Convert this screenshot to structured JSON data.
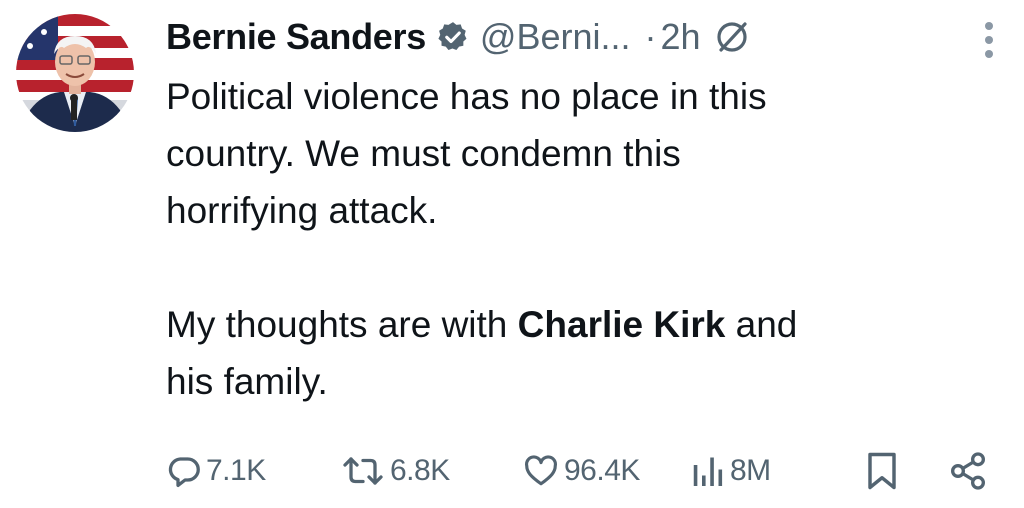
{
  "author": {
    "name": "Bernie Sanders",
    "handle": "@Berni...",
    "separator": "·",
    "time": "2h",
    "avatar_icon": "profile-photo",
    "verified_icon": "verified-badge-icon",
    "verified_color": "#536471"
  },
  "tweet": {
    "line1": "Political violence has no place in this",
    "line2": "country. We must condemn this",
    "line3": "horrifying attack.",
    "line4_prefix": "My thoughts are with ",
    "line4_bold": "Charlie Kirk",
    "line4_suffix": " and",
    "line5": "his family."
  },
  "actions": {
    "replies": "7.1K",
    "reposts": "6.8K",
    "likes": "96.4K",
    "views": "8M"
  },
  "colors": {
    "text": "#0f1419",
    "secondary": "#536471",
    "more": "#8b98a5"
  }
}
